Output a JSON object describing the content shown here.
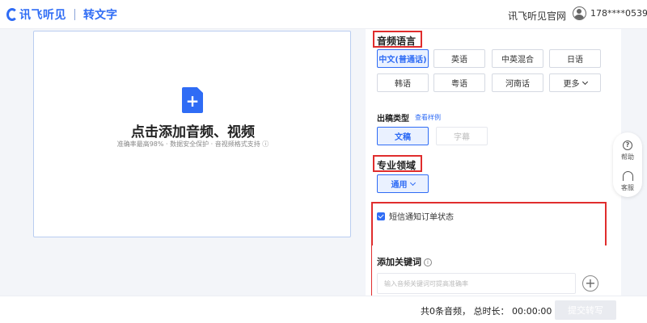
{
  "header": {
    "brand": "讯飞听见",
    "product": "转文字",
    "official_site": "讯飞听见官网",
    "user_phone": "178****0539"
  },
  "upload": {
    "title": "点击添加音频、视频",
    "subtitle": "准确率最高98% · 数据安全保护 · 音视频格式支持 ⓘ"
  },
  "settings": {
    "language": {
      "title": "音频语言",
      "options": [
        "中文(普通话)",
        "英语",
        "中英混合",
        "日语",
        "韩语",
        "粤语",
        "河南话",
        "更多"
      ],
      "selected": "中文(普通话)"
    },
    "output": {
      "title": "出稿类型",
      "link": "查看样例",
      "options": [
        "文稿",
        "字幕"
      ],
      "selected": "文稿"
    },
    "domain": {
      "title": "专业领域",
      "selected": "通用"
    },
    "sms": {
      "label": "短信通知订单状态",
      "checked": true
    },
    "keywords": {
      "title": "添加关键词",
      "placeholder": "输入音频关键词可提高准确率"
    }
  },
  "helper": {
    "help": "帮助",
    "service": "客服"
  },
  "footer": {
    "summary": "共0条音频，  总时长：   00:00:00",
    "submit": "提交转写"
  },
  "colors": {
    "accent": "#2f6cf5",
    "highlight_box": "#e02d2d"
  }
}
